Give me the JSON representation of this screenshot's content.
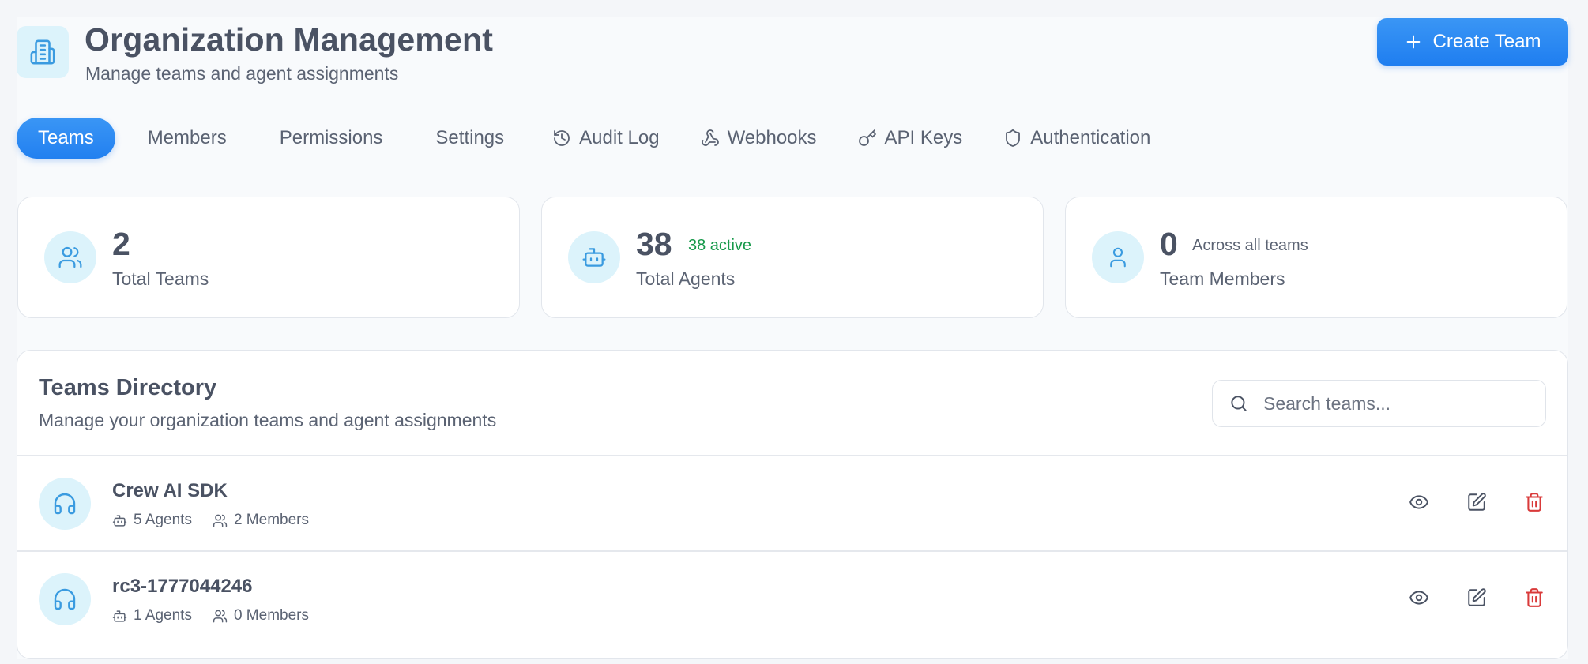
{
  "header": {
    "title": "Organization Management",
    "subtitle": "Manage teams and agent assignments",
    "create_button_label": "Create Team",
    "icon": "building-icon"
  },
  "tabs": [
    {
      "label": "Teams",
      "icon": "",
      "active": true
    },
    {
      "label": "Members",
      "icon": ""
    },
    {
      "label": "Permissions",
      "icon": ""
    },
    {
      "label": "Settings",
      "icon": ""
    },
    {
      "label": "Audit Log",
      "icon": "history-icon"
    },
    {
      "label": "Webhooks",
      "icon": "webhook-icon"
    },
    {
      "label": "API Keys",
      "icon": "key-icon"
    },
    {
      "label": "Authentication",
      "icon": "shield-icon"
    }
  ],
  "stats": {
    "teams": {
      "value": "2",
      "label": "Total Teams",
      "icon": "users-icon"
    },
    "agents": {
      "value": "38",
      "note": "38 active",
      "label": "Total Agents",
      "icon": "bot-icon"
    },
    "members": {
      "value": "0",
      "note": "Across all teams",
      "label": "Team Members",
      "icon": "user-icon"
    }
  },
  "directory": {
    "title": "Teams Directory",
    "subtitle": "Manage your organization teams and agent assignments",
    "search_placeholder": "Search teams...",
    "teams": [
      {
        "name": "Crew AI SDK",
        "agents": "5 Agents",
        "members": "2 Members",
        "icon": "headphones-icon"
      },
      {
        "name": "rc3-1777044246",
        "agents": "1 Agents",
        "members": "0 Members",
        "icon": "headphones-icon"
      }
    ]
  },
  "colors": {
    "accent": "#2280f0",
    "icon_blue": "#3a9be0",
    "icon_bg": "#dcf3fb",
    "success": "#16994a",
    "danger": "#d93a3a"
  }
}
